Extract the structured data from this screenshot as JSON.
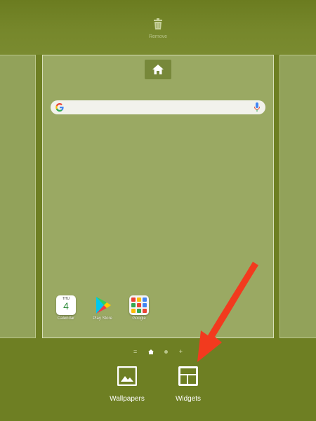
{
  "top_bar": {
    "remove_label": "Remove"
  },
  "search": {
    "placeholder": ""
  },
  "apps": [
    {
      "label": "Calendar",
      "day": "THU",
      "date": "4"
    },
    {
      "label": "Play Store"
    },
    {
      "label": "Google"
    }
  ],
  "page_indicators": [
    "=",
    "home",
    "dot",
    "+"
  ],
  "bottom_bar": {
    "wallpapers_label": "Wallpapers",
    "widgets_label": "Widgets"
  },
  "colors": {
    "background": "#6e7f23",
    "page": "#9aa963",
    "arrow": "#f23a1e"
  }
}
